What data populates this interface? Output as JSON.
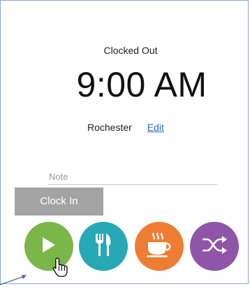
{
  "status": "Clocked Out",
  "time": "9:00 AM",
  "location": "Rochester",
  "edit_label": "Edit",
  "note_placeholder": "Note",
  "clock_in_label": "Clock In",
  "actions": [
    {
      "name": "play-icon",
      "color": "#7ab648"
    },
    {
      "name": "fork-knife-icon",
      "color": "#27a9b5"
    },
    {
      "name": "coffee-cup-icon",
      "color": "#ee7d33"
    },
    {
      "name": "shuffle-icon",
      "color": "#8e55a8"
    }
  ]
}
